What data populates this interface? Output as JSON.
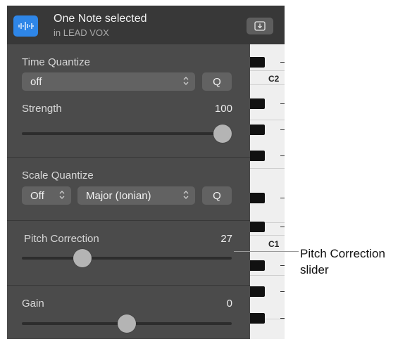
{
  "header": {
    "title": "One Note selected",
    "subtitle": "in LEAD VOX",
    "logo_icon": "waveform-icon",
    "button_icon": "download-tray-icon"
  },
  "time_quantize": {
    "label": "Time Quantize",
    "value": "off",
    "q_label": "Q"
  },
  "strength": {
    "label": "Strength",
    "value": "100",
    "level": 1.0
  },
  "scale_quantize": {
    "label": "Scale Quantize",
    "toggle_value": "Off",
    "scale_value": "Major (Ionian)",
    "q_label": "Q"
  },
  "pitch_correction": {
    "label": "Pitch Correction",
    "value": "27",
    "level": 0.27
  },
  "gain": {
    "label": "Gain",
    "value": "0",
    "level": 0.5
  },
  "piano": {
    "labels": [
      "C2",
      "C1"
    ]
  },
  "callout": {
    "line1": "Pitch Correction",
    "line2": "slider"
  },
  "colors": {
    "accent": "#2e86e8",
    "panel": "#4b4b4b",
    "header": "#383838",
    "control": "#626262",
    "knob": "#b4b4b4"
  }
}
